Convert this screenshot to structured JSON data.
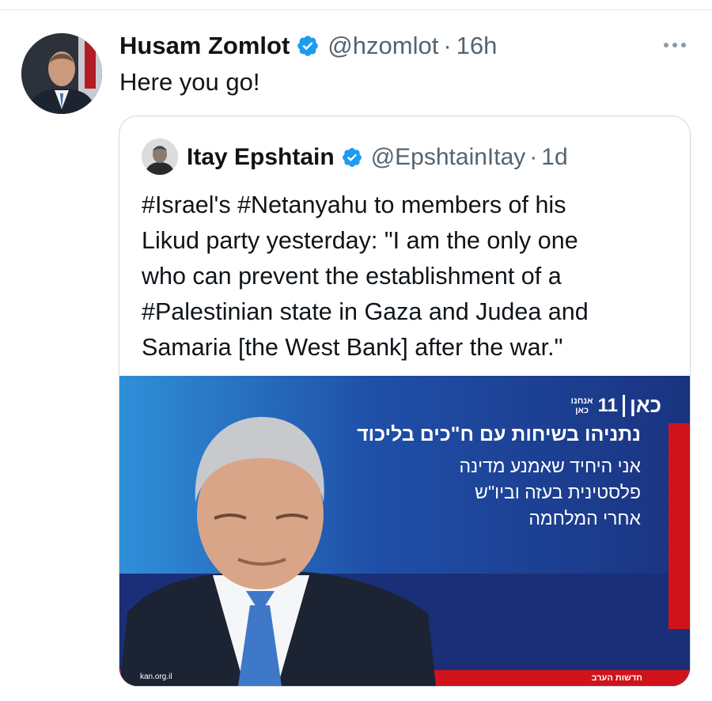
{
  "tweet": {
    "author_name": "Husam Zomlot",
    "handle": "@hzomlot",
    "separator": "·",
    "time": "16h",
    "text": "Here you go!",
    "more_icon": "ellipsis-icon",
    "verified_icon": "verified-badge-icon"
  },
  "quoted_tweet": {
    "author_name": "Itay Epshtain",
    "handle": "@EpshtainItay",
    "separator": "·",
    "time": "1d",
    "text": "#Israel's #Netanyahu to members of his\nLikud party yesterday: \"I am the only one\nwho can prevent the establishment of a\n#Palestinian state in Gaza and Judea and\nSamaria [the West Bank] after the war.\""
  },
  "media": {
    "channel_logo_kan": "כאן",
    "channel_logo_number": "11",
    "channel_logo_anachnu_top": "אנחנו",
    "channel_logo_anachnu_bottom": "כאן",
    "headline": "נתניהו בשיחות עם ח\"כים בליכוד",
    "quote_lines": "אני היחיד שאמנע מדינה\nפלסטינית בעזה וביו\"ש\nאחרי המלחמה",
    "source": "kan.org.il",
    "program": "חדשות הערב"
  },
  "colors": {
    "verified_blue": "#1d9bf0",
    "media_bg": "#1c3b86",
    "media_red": "#d0131b"
  }
}
